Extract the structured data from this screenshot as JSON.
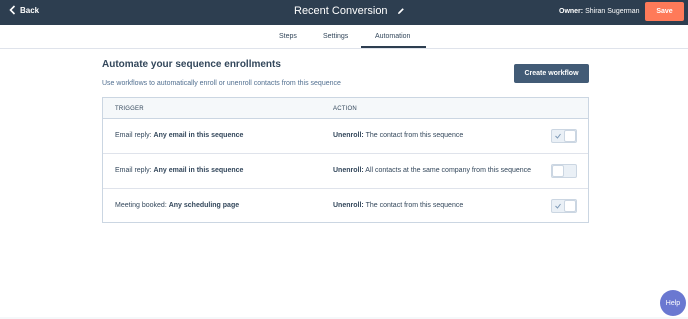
{
  "topbar": {
    "back_label": "Back",
    "title": "Recent Conversion",
    "owner_label": "Owner:",
    "owner_name": "Shiran Sugerman",
    "save_label": "Save"
  },
  "tabs": [
    {
      "label": "Steps"
    },
    {
      "label": "Settings"
    },
    {
      "label": "Automation"
    }
  ],
  "active_tab": "Automation",
  "main": {
    "heading": "Automate your sequence enrollments",
    "subheading": "Use workflows to automatically enroll or unenroll contacts from this sequence",
    "create_button": "Create workflow"
  },
  "table": {
    "headers": {
      "trigger": "TRIGGER",
      "action": "ACTION"
    },
    "rows": [
      {
        "trigger_prefix": "Email reply:",
        "trigger_value": "Any email in this sequence",
        "action_prefix": "Unenroll:",
        "action_value": "The contact from this sequence",
        "enabled": true
      },
      {
        "trigger_prefix": "Email reply:",
        "trigger_value": "Any email in this sequence",
        "action_prefix": "Unenroll:",
        "action_value": "All contacts at the same company from this sequence",
        "enabled": false
      },
      {
        "trigger_prefix": "Meeting booked:",
        "trigger_value": "Any scheduling page",
        "action_prefix": "Unenroll:",
        "action_value": "The contact from this sequence",
        "enabled": true
      }
    ]
  },
  "help_label": "Help",
  "colors": {
    "topbar": "#2d3e50",
    "save": "#ff7a59",
    "create": "#425b76",
    "help": "#6a78d1"
  }
}
